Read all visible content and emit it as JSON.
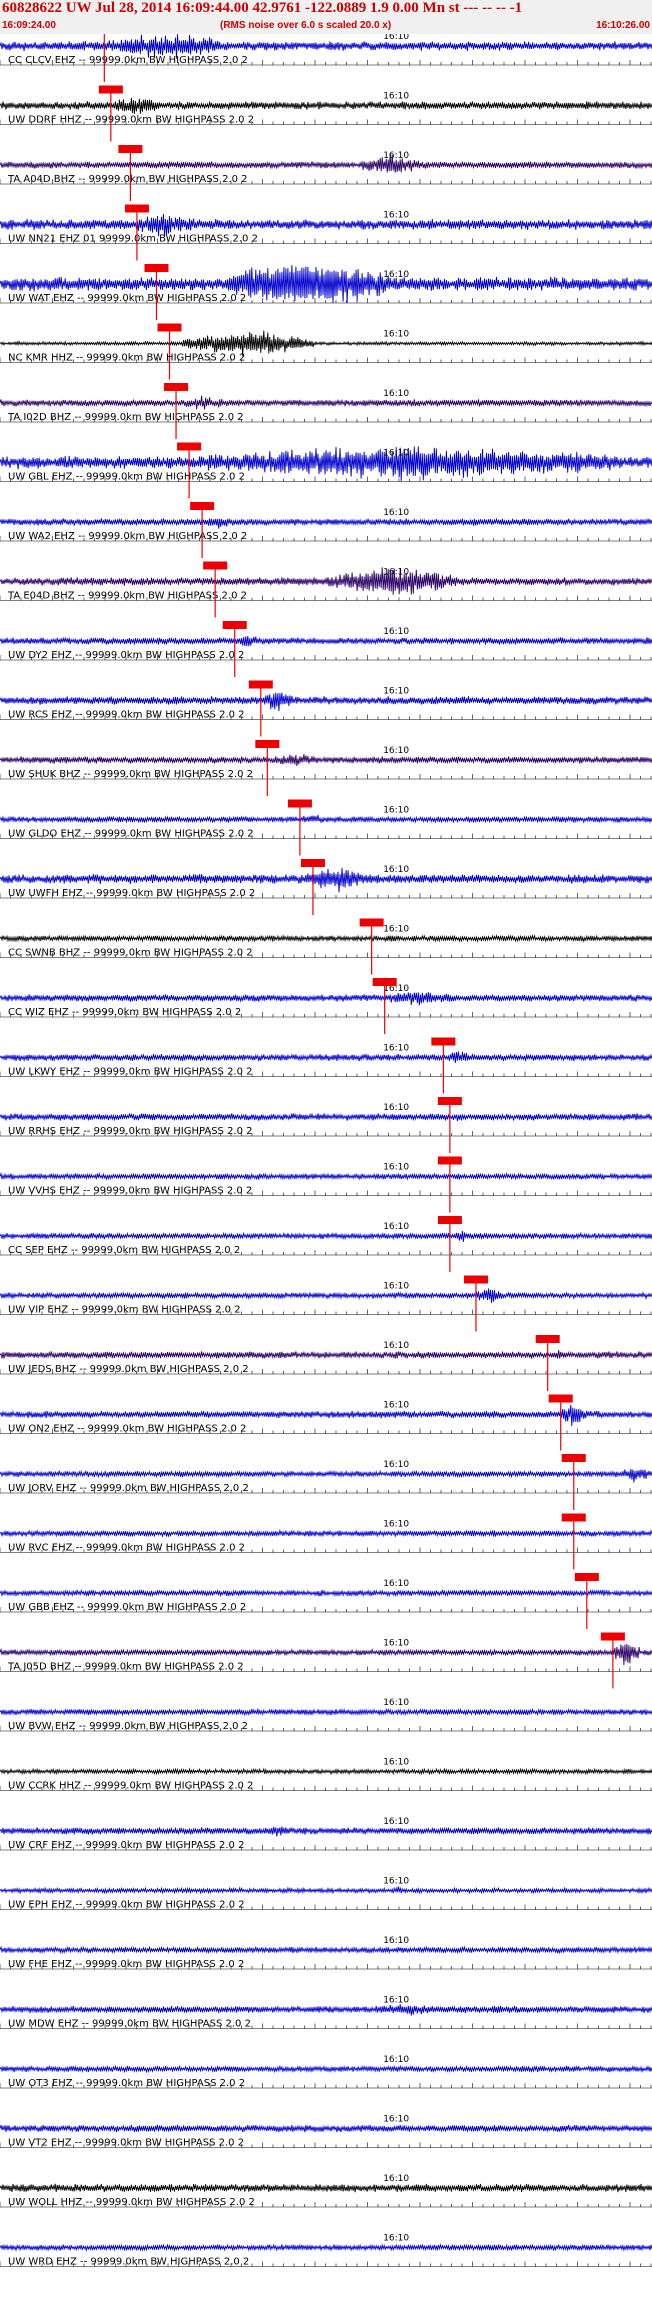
{
  "header": {
    "title": "60828622 UW Jul 28, 2014 16:09:44.00   42.9761 -122.0889  1.9 0.00 Mn st --- -- -- -1",
    "start_time": "16:09:24.00",
    "note": "(RMS noise over 6.0 s scaled 20.0 x)",
    "end_time": "16:10:26.00"
  },
  "chart_data": {
    "type": "line",
    "time_range": [
      "16:09:24.00",
      "16:10:26.00"
    ],
    "tick_label": "16:10",
    "traces": [
      {
        "label": "CC CLCV EHZ -- 99999.0km BW  HIGHPASS  2.0  2",
        "color": "#0000cc",
        "amp": 0.8,
        "pick": 0.16,
        "burst": [
          0.16,
          0.35,
          3.0
        ]
      },
      {
        "label": "UW DDRF HHZ -- 99999.0km BW  HIGHPASS  2.0  2",
        "color": "#000000",
        "amp": 0.7,
        "pick": 0.17,
        "burst": [
          0.17,
          0.25,
          2.5
        ]
      },
      {
        "label": "TA A04D BHZ -- 99999.0km BW  HIGHPASS  2.0  2",
        "color": "#2a0066",
        "amp": 0.6,
        "pick": 0.2,
        "burst": [
          0.55,
          0.65,
          3.0
        ]
      },
      {
        "label": "UW NN21 EHZ 01 99999.0km BW  HIGHPASS  2.0  2",
        "color": "#0000cc",
        "amp": 0.9,
        "pick": 0.21,
        "burst": [
          0.2,
          0.3,
          2.5
        ]
      },
      {
        "label": "UW WAT EHZ -- 99999.0km BW  HIGHPASS  2.0  2",
        "color": "#0000cc",
        "amp": 1.2,
        "pick": 0.24,
        "burst": [
          0.35,
          0.6,
          4.0
        ]
      },
      {
        "label": "NC KMR HHZ -- 99999.0km BW  HIGHPASS  2.0  2",
        "color": "#000000",
        "amp": 0.3,
        "pick": 0.26,
        "burst": [
          0.28,
          0.48,
          8.0
        ]
      },
      {
        "label": "TA I02D BHZ -- 99999.0km BW  HIGHPASS  2.0  2",
        "color": "#2a0066",
        "amp": 0.6,
        "pick": 0.27,
        "burst": [
          0.27,
          0.35,
          2.0
        ]
      },
      {
        "label": "UW GBL EHZ -- 99999.0km BW  HIGHPASS  2.0  2",
        "color": "#0000cc",
        "amp": 1.1,
        "pick": 0.29,
        "burst": [
          0.3,
          0.95,
          3.0
        ]
      },
      {
        "label": "UW WA2 EHZ -- 99999.0km BW  HIGHPASS  2.0  2",
        "color": "#0000cc",
        "amp": 0.6,
        "pick": 0.31,
        "burst": [
          0.31,
          0.36,
          2.0
        ]
      },
      {
        "label": "TA E04D BHZ -- 99999.0km BW  HIGHPASS  2.0  2",
        "color": "#2a0066",
        "amp": 0.7,
        "pick": 0.33,
        "burst": [
          0.5,
          0.7,
          4.0
        ]
      },
      {
        "label": "UW DY2 EHZ -- 99999.0km BW  HIGHPASS  2.0  2",
        "color": "#0000cc",
        "amp": 0.6,
        "pick": 0.36,
        "burst": [
          0.36,
          0.4,
          2.0
        ]
      },
      {
        "label": "UW RCS EHZ -- 99999.0km BW  HIGHPASS  2.0  2",
        "color": "#0000cc",
        "amp": 0.7,
        "pick": 0.4,
        "burst": [
          0.4,
          0.45,
          3.0
        ]
      },
      {
        "label": "UW SHUK BHZ -- 99999.0km BW  HIGHPASS  2.0  2",
        "color": "#2a0066",
        "amp": 0.6,
        "pick": 0.41,
        "burst": [
          0.41,
          0.5,
          2.0
        ]
      },
      {
        "label": "UW GLDO EHZ -- 99999.0km BW  HIGHPASS  2.0  2",
        "color": "#0000cc",
        "amp": 0.5,
        "pick": 0.46,
        "burst": [
          0.46,
          0.5,
          2.0
        ]
      },
      {
        "label": "UW UWFH EHZ -- 99999.0km BW  HIGHPASS  2.0  2",
        "color": "#0000cc",
        "amp": 0.8,
        "pick": 0.48,
        "burst": [
          0.47,
          0.57,
          3.0
        ]
      },
      {
        "label": "CC SWNB BHZ -- 99999.0km BW  HIGHPASS  2.0  2",
        "color": "#000000",
        "amp": 0.5,
        "pick": 0.57,
        "burst": [
          0.58,
          0.62,
          1.5
        ]
      },
      {
        "label": "CC WIZ EHZ -- 99999.0km BW  HIGHPASS  2.0  2",
        "color": "#0000cc",
        "amp": 0.6,
        "pick": 0.59,
        "burst": [
          0.59,
          0.7,
          2.5
        ]
      },
      {
        "label": "UW LKWY EHZ -- 99999.0km BW  HIGHPASS  2.0  2",
        "color": "#0000cc",
        "amp": 0.6,
        "pick": 0.68,
        "burst": [
          0.68,
          0.72,
          2.5
        ]
      },
      {
        "label": "UW RRHS EHZ -- 99999.0km BW  HIGHPASS  2.0  2",
        "color": "#0000cc",
        "amp": 0.6,
        "pick": 0.69,
        "burst": [
          0.69,
          0.72,
          1.5
        ]
      },
      {
        "label": "UW VVHS EHZ -- 99999.0km BW  HIGHPASS  2.0  2",
        "color": "#0000cc",
        "amp": 0.5,
        "pick": 0.69,
        "burst": [
          0.69,
          0.72,
          1.5
        ]
      },
      {
        "label": "CC SEP EHZ -- 99999.0km BW  HIGHPASS  2.0  2",
        "color": "#0000cc",
        "amp": 0.5,
        "pick": 0.69,
        "burst": [
          0.69,
          0.73,
          2.0
        ]
      },
      {
        "label": "UW VIP EHZ -- 99999.0km BW  HIGHPASS  2.0  2",
        "color": "#0000cc",
        "amp": 0.5,
        "pick": 0.73,
        "burst": [
          0.73,
          0.77,
          4.0
        ]
      },
      {
        "label": "UW JEDS BHZ -- 99999.0km BW  HIGHPASS  2.0  2",
        "color": "#2a0066",
        "amp": 0.6,
        "pick": 0.84,
        "burst": [
          0.84,
          0.88,
          1.5
        ]
      },
      {
        "label": "UW ON2 EHZ -- 99999.0km BW  HIGHPASS  2.0  2",
        "color": "#0000cc",
        "amp": 0.6,
        "pick": 0.86,
        "burst": [
          0.86,
          0.9,
          4.0
        ]
      },
      {
        "label": "UW JORV EHZ -- 99999.0km BW  HIGHPASS  2.0  2",
        "color": "#0000cc",
        "amp": 0.5,
        "pick": 0.88,
        "burst": [
          0.95,
          1.0,
          3.0
        ]
      },
      {
        "label": "UW RVC EHZ -- 99999.0km BW  HIGHPASS  2.0  2",
        "color": "#0000cc",
        "amp": 0.5,
        "pick": 0.88,
        "burst": [
          0.88,
          0.92,
          1.5
        ]
      },
      {
        "label": "UW GBB EHZ -- 99999.0km BW  HIGHPASS  2.0  2",
        "color": "#0000cc",
        "amp": 0.5,
        "pick": 0.9,
        "burst": [
          0.91,
          0.94,
          1.5
        ]
      },
      {
        "label": "TA J05D BHZ -- 99999.0km BW  HIGHPASS  2.0  2",
        "color": "#2a0066",
        "amp": 0.5,
        "pick": 0.94,
        "burst": [
          0.94,
          0.98,
          5.0
        ]
      },
      {
        "label": "UW BVW EHZ -- 99999.0km BW  HIGHPASS  2.0  2",
        "color": "#0000cc",
        "amp": 0.5
      },
      {
        "label": "UW CCRK HHZ -- 99999.0km BW  HIGHPASS  2.0  2",
        "color": "#000000",
        "amp": 0.4
      },
      {
        "label": "UW CRF EHZ -- 99999.0km BW  HIGHPASS  2.0  2",
        "color": "#0000cc",
        "amp": 0.6,
        "burst": [
          0.4,
          0.45,
          2.0
        ]
      },
      {
        "label": "UW EPH EHZ -- 99999.0km BW  HIGHPASS  2.0  2",
        "color": "#0000cc",
        "amp": 0.4,
        "burst": [
          0.6,
          0.62,
          2.0
        ]
      },
      {
        "label": "UW FHE EHZ -- 99999.0km BW  HIGHPASS  2.0  2",
        "color": "#0000cc",
        "amp": 0.5
      },
      {
        "label": "UW MDW EHZ -- 99999.0km BW  HIGHPASS  2.0  2",
        "color": "#0000cc",
        "amp": 0.6,
        "burst": [
          0.55,
          0.7,
          1.8
        ]
      },
      {
        "label": "UW OT3 EHZ -- 99999.0km BW  HIGHPASS  2.0  2",
        "color": "#0000cc",
        "amp": 0.5
      },
      {
        "label": "UW VT2 EHZ -- 99999.0km BW  HIGHPASS  2.0  2",
        "color": "#0000cc",
        "amp": 0.6
      },
      {
        "label": "UW WOLL HHZ -- 99999.0km BW  HIGHPASS  2.0  2",
        "color": "#000000",
        "amp": 0.7
      },
      {
        "label": "UW WRD EHZ -- 99999.0km BW  HIGHPASS  2.0  2",
        "color": "#0000cc",
        "amp": 0.5
      }
    ]
  }
}
